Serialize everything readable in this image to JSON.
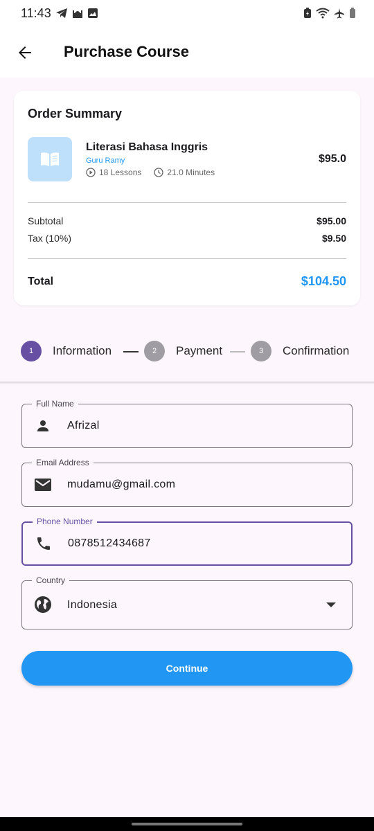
{
  "status_bar": {
    "time": "11:43"
  },
  "header": {
    "title": "Purchase Course"
  },
  "order_summary": {
    "title": "Order Summary",
    "course": {
      "name": "Literasi Bahasa Inggris",
      "teacher": "Guru Ramy",
      "lessons": "18 Lessons",
      "duration": "21.0 Minutes",
      "price": "$95.0"
    },
    "subtotal_label": "Subtotal",
    "subtotal_value": "$95.00",
    "tax_label": "Tax (10%)",
    "tax_value": "$9.50",
    "total_label": "Total",
    "total_value": "$104.50"
  },
  "stepper": {
    "steps": [
      {
        "number": "1",
        "label": "Information",
        "state": "active"
      },
      {
        "number": "2",
        "label": "Payment",
        "state": "inactive"
      },
      {
        "number": "3",
        "label": "Confirmation",
        "state": "inactive"
      }
    ]
  },
  "form": {
    "full_name": {
      "label": "Full Name",
      "value": "Afrizal",
      "icon": "person-icon"
    },
    "email": {
      "label": "Email Address",
      "value": "mudamu@gmail.com",
      "icon": "mail-icon"
    },
    "phone": {
      "label": "Phone Number",
      "value": "0878512434687",
      "icon": "phone-icon"
    },
    "country": {
      "label": "Country",
      "value": "Indonesia",
      "icon": "globe-icon"
    }
  },
  "continue_label": "Continue",
  "colors": {
    "primary": "#2196f3",
    "accent": "#6750a4",
    "background": "#fdf6fd",
    "step_inactive": "#a09ca3"
  }
}
